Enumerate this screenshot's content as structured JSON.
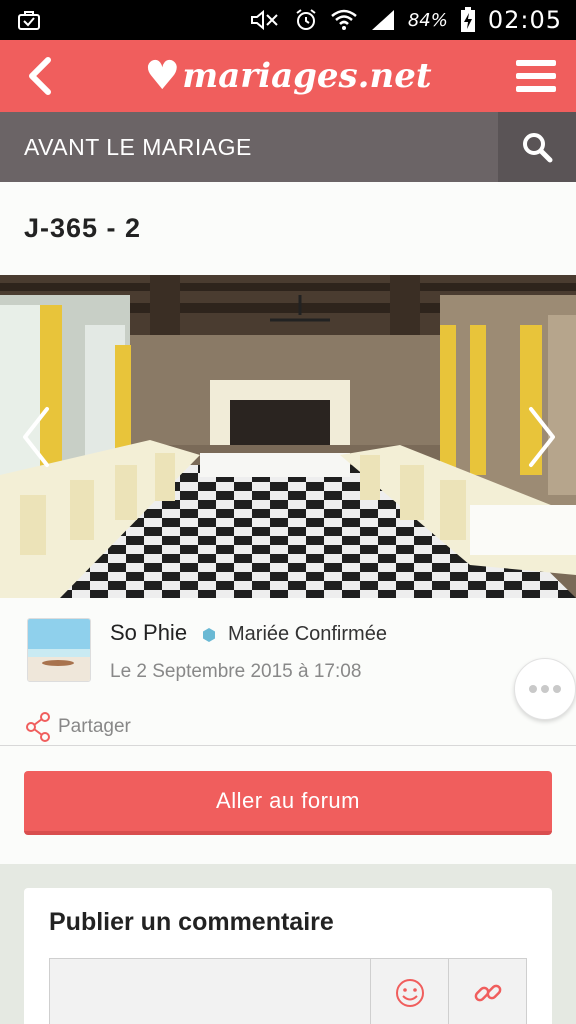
{
  "status_bar": {
    "battery": "84%",
    "time": "02:05",
    "icons": [
      "briefcase-icon",
      "mute-icon",
      "alarm-icon",
      "wifi-icon",
      "signal-icon",
      "battery-charging-icon"
    ]
  },
  "header": {
    "logo_text": "mariages.net",
    "back_icon": "chevron-left-icon",
    "menu_icon": "hamburger-icon",
    "background": "#f05e5d"
  },
  "section": {
    "title": "AVANT LE MARIAGE",
    "search_icon": "search-icon"
  },
  "post": {
    "title": "J-365 - 2"
  },
  "photo": {
    "prev_icon": "chevron-left-icon",
    "next_icon": "chevron-right-icon"
  },
  "author": {
    "name": "So Phie",
    "badge": "Mariée Confirmée",
    "date": "Le 2 Septembre 2015 à 17:08",
    "share_label": "Partager",
    "more_icon": "more-dots-icon"
  },
  "forum": {
    "button_label": "Aller au forum"
  },
  "comment": {
    "title": "Publier un commentaire",
    "placeholder": "",
    "emoji_icon": "smiley-icon",
    "link_icon": "link-icon"
  }
}
